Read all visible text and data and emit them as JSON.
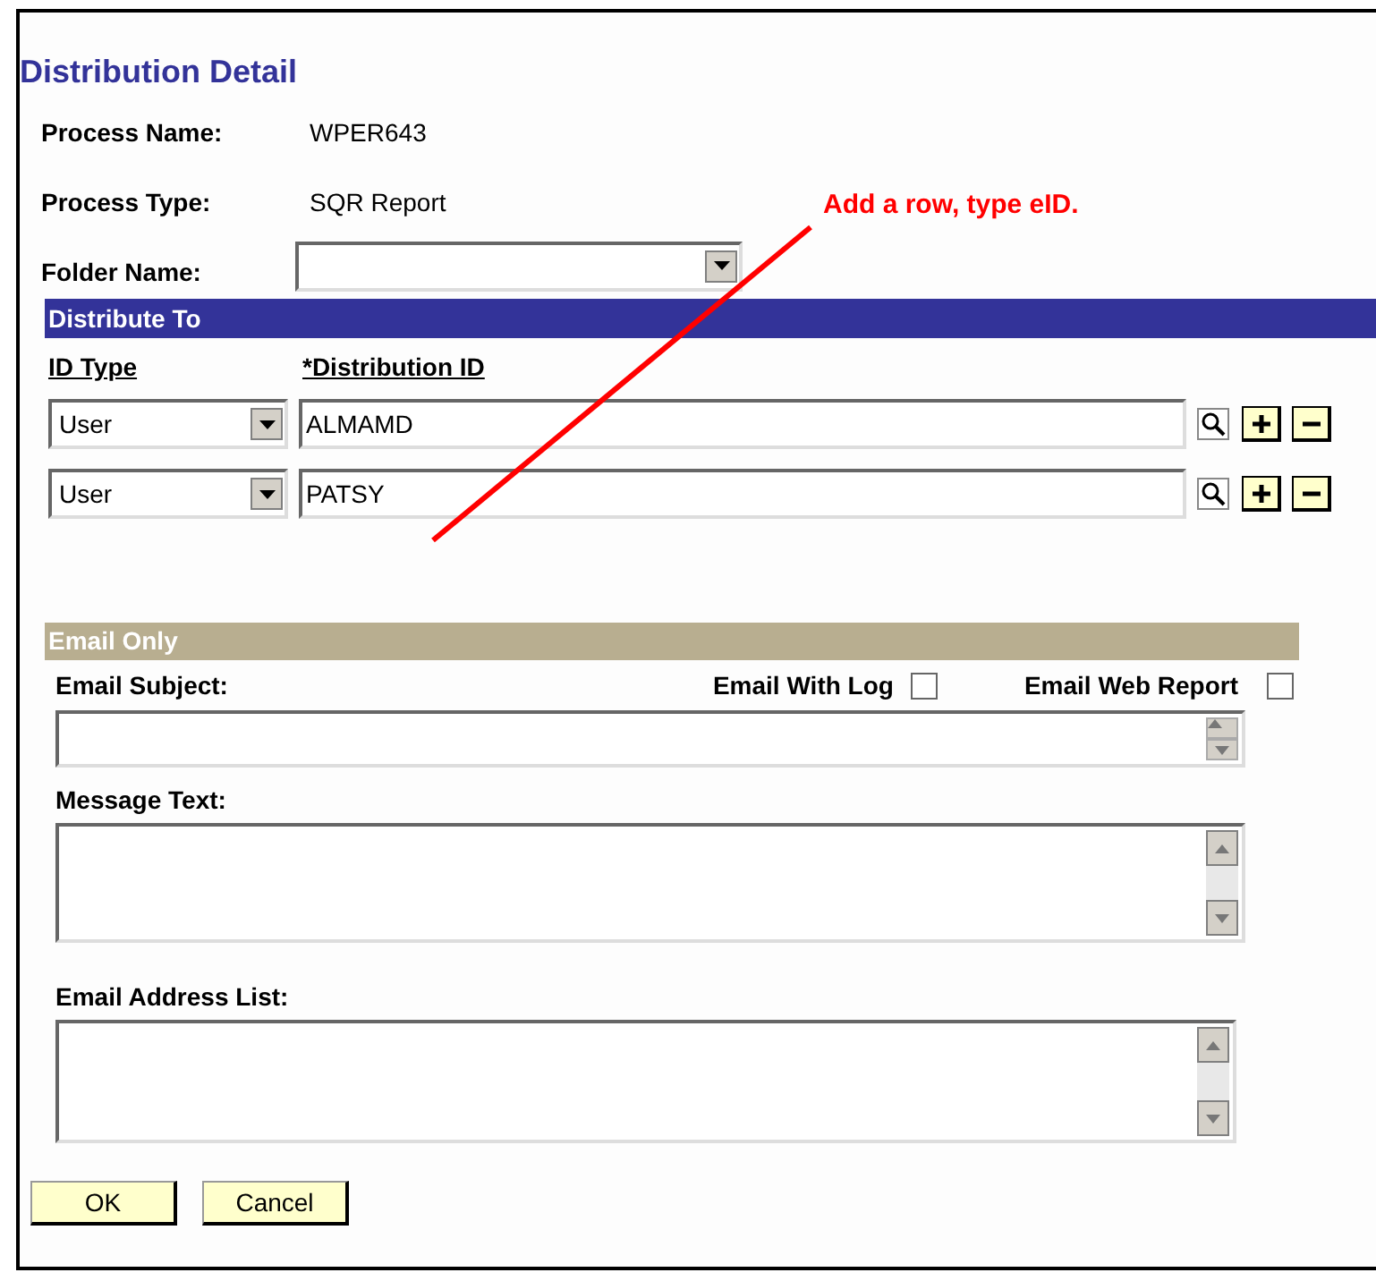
{
  "title": "Distribution Detail",
  "process": [
    {
      "label": "Process Name:",
      "value": "WPER643"
    },
    {
      "label": "Process Type:",
      "value": "SQR Report"
    }
  ],
  "folder": {
    "label": "Folder Name:"
  },
  "distribute_to": {
    "header": "Distribute To",
    "columns": [
      "ID Type",
      "*Distribution ID"
    ],
    "rows": [
      {
        "id_type": "User",
        "distribution_id": "ALMAMD"
      },
      {
        "id_type": "User",
        "distribution_id": "PATSY"
      }
    ]
  },
  "email_only": {
    "header": "Email Only",
    "subject_label": "Email Subject:",
    "checks": [
      {
        "label": "Email With Log",
        "checked": false
      },
      {
        "label": "Email Web Report",
        "checked": false
      }
    ],
    "message_label": "Message Text:",
    "address_label": "Email Address List:"
  },
  "buttons": [
    "OK",
    "Cancel"
  ],
  "annotation": "Add a row, type eID."
}
